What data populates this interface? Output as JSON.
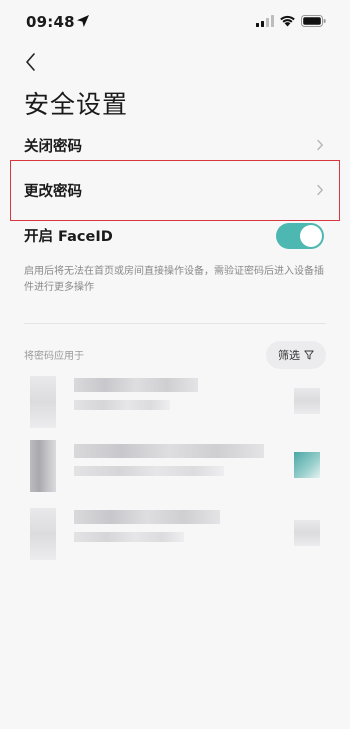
{
  "status_bar": {
    "time": "09:48",
    "icons": [
      "location-arrow-icon",
      "signal-icon",
      "wifi-icon",
      "battery-icon"
    ]
  },
  "header": {
    "back_icon": "chevron-left-icon",
    "title": "安全设置"
  },
  "settings": {
    "close_password": "关闭密码",
    "change_password": "更改密码",
    "face_id": "开启 FaceID",
    "face_id_enabled": true,
    "description": "启用后将无法在首页或房间直接操作设备，需验证密码后进入设备插件进行更多操作"
  },
  "apply_section": {
    "label": "将密码应用于",
    "filter_label": "筛选",
    "filter_icon": "funnel-icon",
    "devices_note": "device names are pixelated / obscured in the screenshot",
    "device_count": 3
  },
  "colors": {
    "toggle_on": "#4db7b1",
    "highlight_border": "#d9363e",
    "background": "#f7f7f8"
  }
}
